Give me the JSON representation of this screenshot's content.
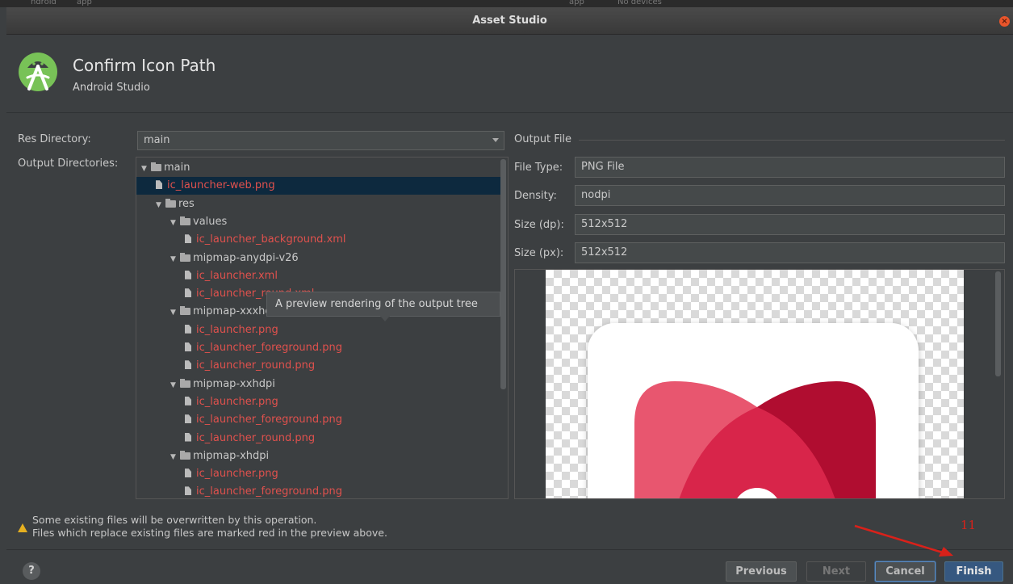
{
  "window": {
    "background_strip": [
      "ndroid",
      "app",
      "app",
      "No devices"
    ],
    "title": "Asset Studio",
    "close_glyph": "×"
  },
  "header": {
    "title": "Confirm Icon Path",
    "subtitle": "Android Studio"
  },
  "form": {
    "res_directory_label": "Res Directory:",
    "res_directory_value": "main",
    "output_directories_label": "Output Directories:"
  },
  "tree": {
    "items": [
      {
        "name": "main",
        "kind": "folder",
        "depth": 0,
        "expanded": true
      },
      {
        "name": "ic_launcher-web.png",
        "kind": "file",
        "depth": 1,
        "selected": true
      },
      {
        "name": "res",
        "kind": "folder",
        "depth": 1,
        "expanded": true
      },
      {
        "name": "values",
        "kind": "folder",
        "depth": 2,
        "expanded": true
      },
      {
        "name": "ic_launcher_background.xml",
        "kind": "file",
        "depth": 3
      },
      {
        "name": "mipmap-anydpi-v26",
        "kind": "folder",
        "depth": 2,
        "expanded": true
      },
      {
        "name": "ic_launcher.xml",
        "kind": "file",
        "depth": 3
      },
      {
        "name": "ic_launcher_round.xml",
        "kind": "file",
        "depth": 3
      },
      {
        "name": "mipmap-xxxhdpi",
        "kind": "folder",
        "depth": 2,
        "expanded": true
      },
      {
        "name": "ic_launcher.png",
        "kind": "file",
        "depth": 3
      },
      {
        "name": "ic_launcher_foreground.png",
        "kind": "file",
        "depth": 3
      },
      {
        "name": "ic_launcher_round.png",
        "kind": "file",
        "depth": 3
      },
      {
        "name": "mipmap-xxhdpi",
        "kind": "folder",
        "depth": 2,
        "expanded": true
      },
      {
        "name": "ic_launcher.png",
        "kind": "file",
        "depth": 3
      },
      {
        "name": "ic_launcher_foreground.png",
        "kind": "file",
        "depth": 3
      },
      {
        "name": "ic_launcher_round.png",
        "kind": "file",
        "depth": 3
      },
      {
        "name": "mipmap-xhdpi",
        "kind": "folder",
        "depth": 2,
        "expanded": true
      },
      {
        "name": "ic_launcher.png",
        "kind": "file",
        "depth": 3
      },
      {
        "name": "ic_launcher_foreground.png",
        "kind": "file",
        "depth": 3
      }
    ],
    "tooltip": "A preview rendering of the output tree"
  },
  "output_file": {
    "legend": "Output File",
    "file_type_label": "File Type:",
    "file_type_value": "PNG File",
    "density_label": "Density:",
    "density_value": "nodpi",
    "size_dp_label": "Size (dp):",
    "size_dp_value": "512x512",
    "size_px_label": "Size (px):",
    "size_px_value": "512x512"
  },
  "warning": {
    "line1": "Some existing files will be overwritten by this operation.",
    "line2": "Files which replace existing files are marked red in the preview above."
  },
  "buttons": {
    "help": "?",
    "previous": "Previous",
    "next": "Next",
    "cancel": "Cancel",
    "finish": "Finish"
  },
  "annotation": {
    "step_number": "11"
  },
  "colors": {
    "replaced_file": "#e0514d",
    "accent_primary": "#365880",
    "icon_pink_light": "#e8566f",
    "icon_crimson": "#b00d30",
    "annotation_red": "#d9211a"
  }
}
